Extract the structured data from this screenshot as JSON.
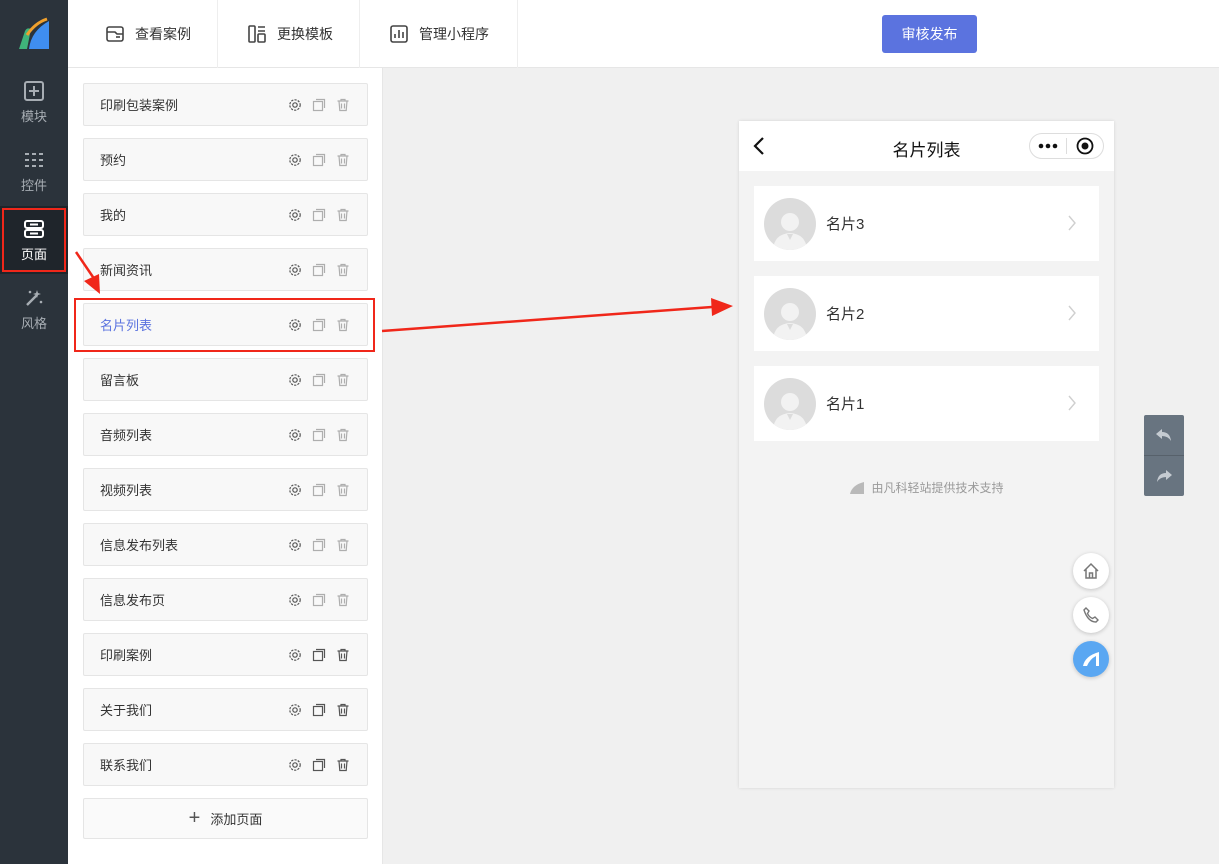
{
  "nav": {
    "items": [
      {
        "label": "模块",
        "icon": "plus-square-icon"
      },
      {
        "label": "控件",
        "icon": "sliders-icon"
      },
      {
        "label": "页面",
        "icon": "pages-icon"
      },
      {
        "label": "风格",
        "icon": "magic-wand-icon"
      }
    ],
    "active_index": 2
  },
  "toolbar": {
    "view_cases": "查看案例",
    "change_template": "更换模板",
    "manage_miniapp": "管理小程序",
    "publish": "审核发布"
  },
  "pages": [
    {
      "label": "印刷包装案例",
      "deletable": false
    },
    {
      "label": "预约",
      "deletable": false
    },
    {
      "label": "我的",
      "deletable": false
    },
    {
      "label": "新闻资讯",
      "deletable": false
    },
    {
      "label": "名片列表",
      "deletable": false,
      "selected": true
    },
    {
      "label": "留言板",
      "deletable": false
    },
    {
      "label": "音频列表",
      "deletable": false
    },
    {
      "label": "视频列表",
      "deletable": false
    },
    {
      "label": "信息发布列表",
      "deletable": false
    },
    {
      "label": "信息发布页",
      "deletable": false
    },
    {
      "label": "印刷案例",
      "deletable": true
    },
    {
      "label": "关于我们",
      "deletable": true
    },
    {
      "label": "联系我们",
      "deletable": true
    }
  ],
  "add_page": "添加页面",
  "phone": {
    "title": "名片列表",
    "cards": [
      {
        "name": "名片3"
      },
      {
        "name": "名片2"
      },
      {
        "name": "名片1"
      }
    ],
    "powered_by": "由凡科轻站提供技术支持"
  },
  "colors": {
    "accent": "#5b73df",
    "highlight": "#f0271a",
    "nav_bg": "#2b333b"
  }
}
